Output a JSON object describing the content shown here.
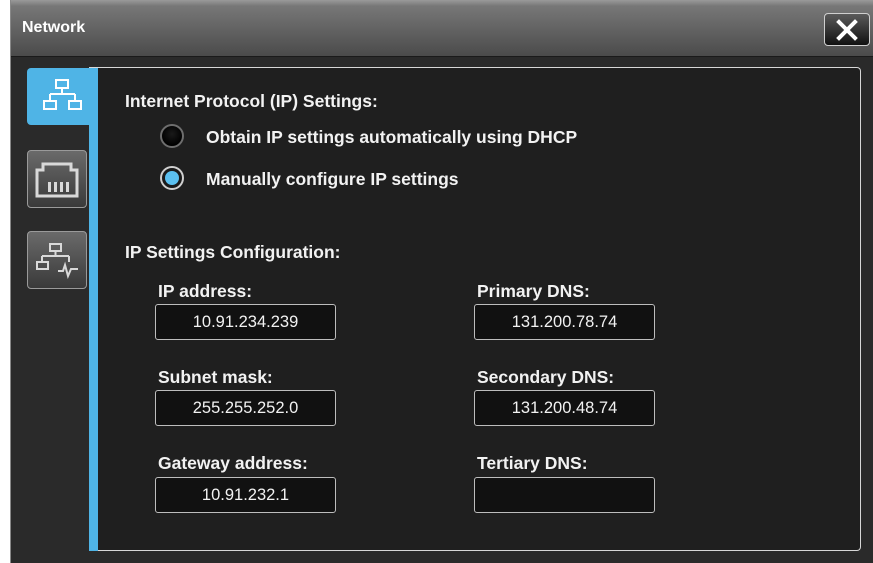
{
  "window": {
    "title": "Network"
  },
  "icons": {
    "close": "close-icon",
    "tab_network": "network-icon",
    "tab_ethernet": "ethernet-port-icon",
    "tab_diagnostics": "network-diagnostics-icon"
  },
  "colors": {
    "accent": "#4fb4e6",
    "background": "#2a2a2a"
  },
  "ip_settings": {
    "heading": "Internet Protocol (IP) Settings:",
    "options": [
      {
        "label": "Obtain IP settings automatically using DHCP",
        "selected": false
      },
      {
        "label": "Manually configure IP settings",
        "selected": true
      }
    ]
  },
  "config": {
    "heading": "IP Settings Configuration:",
    "ip_address": {
      "label": "IP address:",
      "value": "10.91.234.239"
    },
    "subnet_mask": {
      "label": "Subnet mask:",
      "value": "255.255.252.0"
    },
    "gateway": {
      "label": "Gateway address:",
      "value": "10.91.232.1"
    },
    "primary_dns": {
      "label": "Primary DNS:",
      "value": "131.200.78.74"
    },
    "secondary_dns": {
      "label": "Secondary DNS:",
      "value": "131.200.48.74"
    },
    "tertiary_dns": {
      "label": "Tertiary DNS:",
      "value": ""
    }
  }
}
